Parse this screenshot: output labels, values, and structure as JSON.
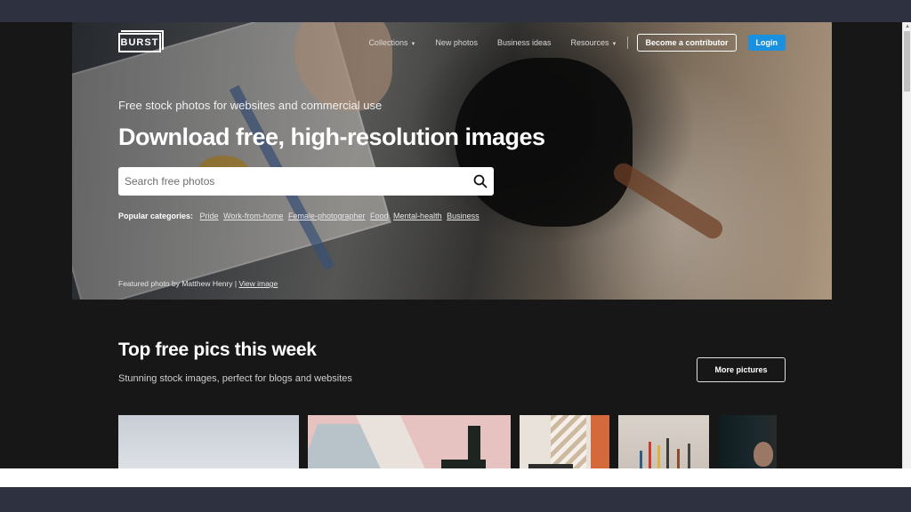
{
  "nav": {
    "logo_text": "BURST",
    "links": [
      {
        "label": "Collections",
        "has_caret": true
      },
      {
        "label": "New photos",
        "has_caret": false
      },
      {
        "label": "Business ideas",
        "has_caret": false
      },
      {
        "label": "Resources",
        "has_caret": true
      }
    ],
    "contributor_button": "Become a contributor",
    "login_button": "Login"
  },
  "hero": {
    "kicker": "Free stock photos for websites and commercial use",
    "title": "Download free, high-resolution images",
    "search": {
      "placeholder": "Search free photos",
      "value": "",
      "icon": "search-icon"
    },
    "popular_label": "Popular categories:",
    "popular_categories": [
      "Pride",
      "Work-from-home",
      "Female-photographer",
      "Food",
      "Mental-health",
      "Business"
    ],
    "credit_text": "Featured photo by Matthew Henry |",
    "credit_link": "View image"
  },
  "section": {
    "title": "Top free pics this week",
    "subtitle": "Stunning stock images, perfect for blogs and websites",
    "more_button": "More pictures"
  },
  "colors": {
    "page_background": "#171717",
    "chrome_band": "#2e3240",
    "login_blue": "#1990e0",
    "text_white": "#ffffff"
  }
}
